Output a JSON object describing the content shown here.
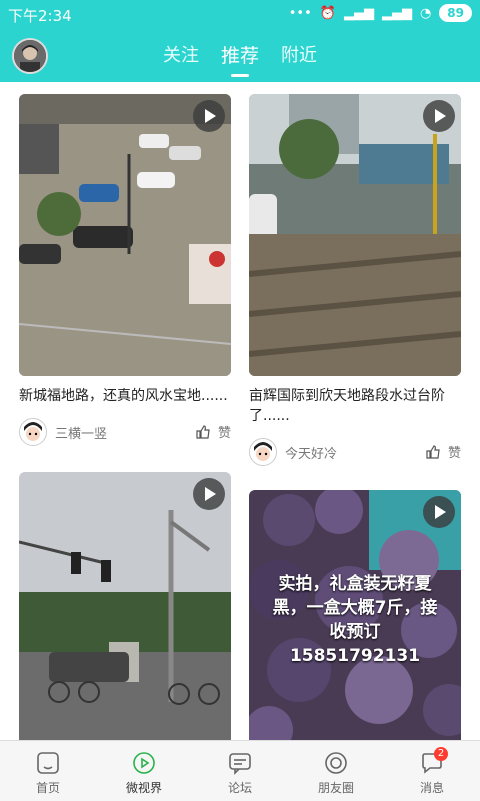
{
  "status": {
    "time": "下午2:34",
    "battery": "89"
  },
  "tabs": [
    {
      "label": "关注",
      "active": false
    },
    {
      "label": "推荐",
      "active": true
    },
    {
      "label": "附近",
      "active": false
    }
  ],
  "cards": [
    {
      "caption": "新城福地路，还真的风水宝地......",
      "user": "三横一竖",
      "like": "赞"
    },
    {
      "caption": "亩辉国际到欣天地路段水过台阶了......",
      "user": "今天好冷",
      "like": "赞"
    },
    {
      "caption": "",
      "user": "",
      "like": ""
    },
    {
      "caption": "",
      "overlay": "实拍，礼盒装无籽夏黑，一盒大概7斤，接收预订\n15851792131",
      "user": "",
      "like": ""
    }
  ],
  "nav": [
    {
      "label": "首页",
      "icon": "home-icon"
    },
    {
      "label": "微视界",
      "icon": "play-circle-icon",
      "active": true
    },
    {
      "label": "论坛",
      "icon": "forum-icon"
    },
    {
      "label": "朋友圈",
      "icon": "moments-icon"
    },
    {
      "label": "消息",
      "icon": "message-icon",
      "badge": "2"
    }
  ],
  "colors": {
    "accent": "#2bd4cf",
    "badge": "#ff3b30"
  }
}
